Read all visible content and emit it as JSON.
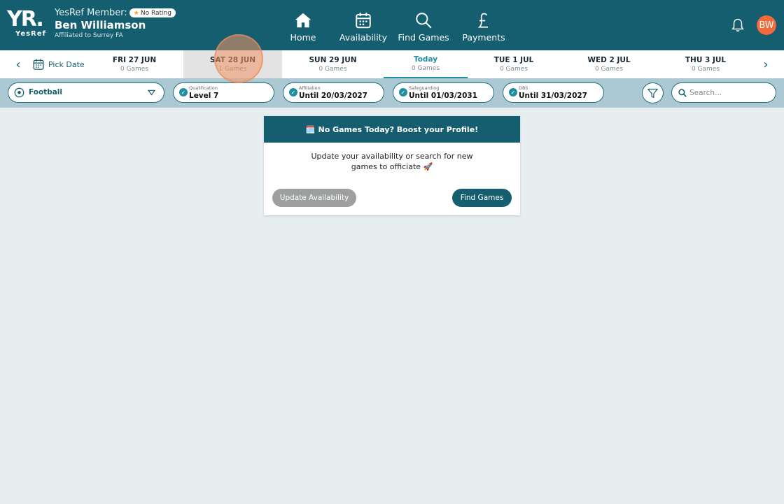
{
  "header": {
    "logo_text": "YR.",
    "logo_sub": "YesRef",
    "member_prefix": "YesRef Member:",
    "rating_label": "No Rating",
    "member_name": "Ben Williamson",
    "affiliation": "Affiliated to Surrey FA",
    "avatar_initials": "BW",
    "nav": [
      {
        "label": "Home",
        "icon": "home-icon"
      },
      {
        "label": "Availability",
        "icon": "calendar-icon"
      },
      {
        "label": "Find Games",
        "icon": "search-icon"
      },
      {
        "label": "Payments",
        "icon": "pound-icon"
      }
    ]
  },
  "datebar": {
    "pick_date_label": "Pick Date",
    "days": [
      {
        "name": "FRI 27 JUN",
        "count": "0 Games"
      },
      {
        "name": "SAT 28 JUN",
        "count": "1 Games"
      },
      {
        "name": "SUN 29 JUN",
        "count": "0 Games"
      },
      {
        "name": "Today",
        "count": "0 Games"
      },
      {
        "name": "TUE 1 JUL",
        "count": "0 Games"
      },
      {
        "name": "WED 2 JUL",
        "count": "0 Games"
      },
      {
        "name": "THU 3 JUL",
        "count": "0 Games"
      }
    ]
  },
  "filters": {
    "sport": "Football",
    "qualification": {
      "label": "Qualification",
      "value": "Level 7"
    },
    "affiliation": {
      "label": "Affiliation",
      "value": "Until 20/03/2027"
    },
    "safeguarding": {
      "label": "Safeguarding",
      "value": "Until 01/03/2031"
    },
    "dbs": {
      "label": "DBS",
      "value": "Until 31/03/2027"
    },
    "search_placeholder": "Search..."
  },
  "card": {
    "title_emoji": "🗓️",
    "title": "No Games Today? Boost your Profile!",
    "body": "Update your availability or search for new games to officiate 🚀",
    "btn_availability": "Update Availability",
    "btn_find": "Find Games"
  },
  "colors": {
    "brand": "#155e6f",
    "accent": "#1f8fa0",
    "avatar": "#f06a3c",
    "filter_bg": "#acc9d3"
  }
}
